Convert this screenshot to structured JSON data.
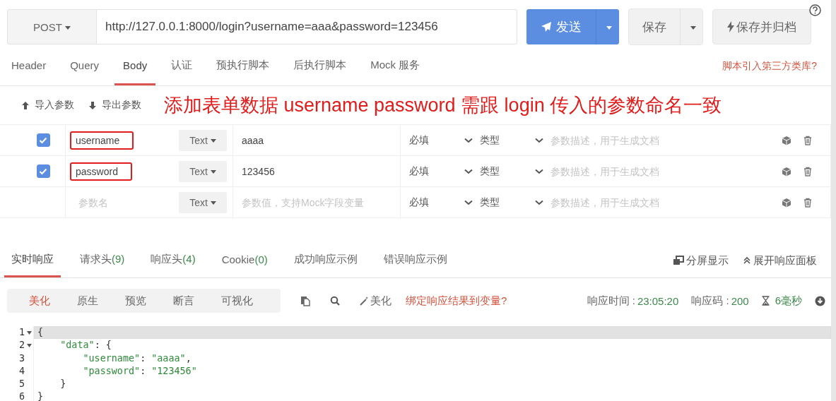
{
  "request": {
    "method": "POST",
    "url": "http://127.0.0.1:8000/login?username=aaa&password=123456",
    "send": "发送",
    "save": "保存",
    "save_archive": "保存并归档"
  },
  "tabs": [
    {
      "label": "Header",
      "selected": false
    },
    {
      "label": "Query",
      "selected": false
    },
    {
      "label": "Body",
      "selected": true
    },
    {
      "label": "认证",
      "selected": false
    },
    {
      "label": "预执行脚本",
      "selected": false
    },
    {
      "label": "后执行脚本",
      "selected": false
    },
    {
      "label": "Mock 服务",
      "selected": false
    }
  ],
  "script_link": "脚本引入第三方类库?",
  "toolbar": {
    "import": "导入参数",
    "export": "导出参数"
  },
  "annotation": "添加表单数据  username password 需跟 login 传入的参数命名一致",
  "params": [
    {
      "kind": "param",
      "checked": true,
      "highlighted": true,
      "name": "username",
      "type": "Text",
      "value": "aaaa",
      "required": "必填",
      "datatype": "类型",
      "description_placeholder": "参数描述，用于生成文档"
    },
    {
      "kind": "param",
      "checked": true,
      "highlighted": true,
      "name": "password",
      "type": "Text",
      "value": "123456",
      "required": "必填",
      "datatype": "类型",
      "description_placeholder": "参数描述，用于生成文档"
    },
    {
      "kind": "new",
      "name_placeholder": "参数名",
      "type": "Text",
      "value_placeholder": "参数值，支持Mock字段变量",
      "required": "必填",
      "datatype": "类型",
      "description_placeholder": "参数描述，用于生成文档"
    }
  ],
  "response_tabs": [
    {
      "label": "实时响应",
      "selected": true
    },
    {
      "label": "请求头",
      "count": "(9)",
      "selected": false
    },
    {
      "label": "响应头",
      "count": "(4)",
      "selected": false
    },
    {
      "label": "Cookie",
      "count": "(0)",
      "selected": false
    },
    {
      "label": "成功响应示例",
      "selected": false
    },
    {
      "label": "错误响应示例",
      "selected": false
    }
  ],
  "split_view": "分屏显示",
  "expand_panel": "展开响应面板",
  "view_modes": [
    {
      "label": "美化",
      "selected": true
    },
    {
      "label": "原生",
      "selected": false
    },
    {
      "label": "预览",
      "selected": false
    },
    {
      "label": "断言",
      "selected": false
    },
    {
      "label": "可视化",
      "selected": false
    }
  ],
  "beautify": "美化",
  "bind_link": "绑定响应结果到变量?",
  "stats": [
    {
      "label": "响应时间 :",
      "value": "23:05:20"
    },
    {
      "label": "响应码 :",
      "value": "200"
    }
  ],
  "duration": "6毫秒",
  "code": [
    {
      "number": "1",
      "foldable": true,
      "current": true,
      "tokens": [
        {
          "kind": "punct",
          "text": "{"
        }
      ]
    },
    {
      "number": "2",
      "foldable": true,
      "current": false,
      "tokens": [
        {
          "kind": "key",
          "text": "    \"data\""
        },
        {
          "kind": "punct",
          "text": ": {"
        }
      ]
    },
    {
      "number": "3",
      "foldable": false,
      "current": false,
      "tokens": [
        {
          "kind": "key",
          "text": "        \"username\""
        },
        {
          "kind": "punct",
          "text": ": "
        },
        {
          "kind": "string",
          "text": "\"aaaa\""
        },
        {
          "kind": "punct",
          "text": ","
        }
      ]
    },
    {
      "number": "4",
      "foldable": false,
      "current": false,
      "tokens": [
        {
          "kind": "key",
          "text": "        \"password\""
        },
        {
          "kind": "punct",
          "text": ": "
        },
        {
          "kind": "string",
          "text": "\"123456\""
        }
      ]
    },
    {
      "number": "5",
      "foldable": false,
      "current": false,
      "tokens": [
        {
          "kind": "punct",
          "text": "    }"
        }
      ]
    },
    {
      "number": "6",
      "foldable": false,
      "current": false,
      "tokens": [
        {
          "kind": "punct",
          "text": "}"
        }
      ]
    }
  ]
}
